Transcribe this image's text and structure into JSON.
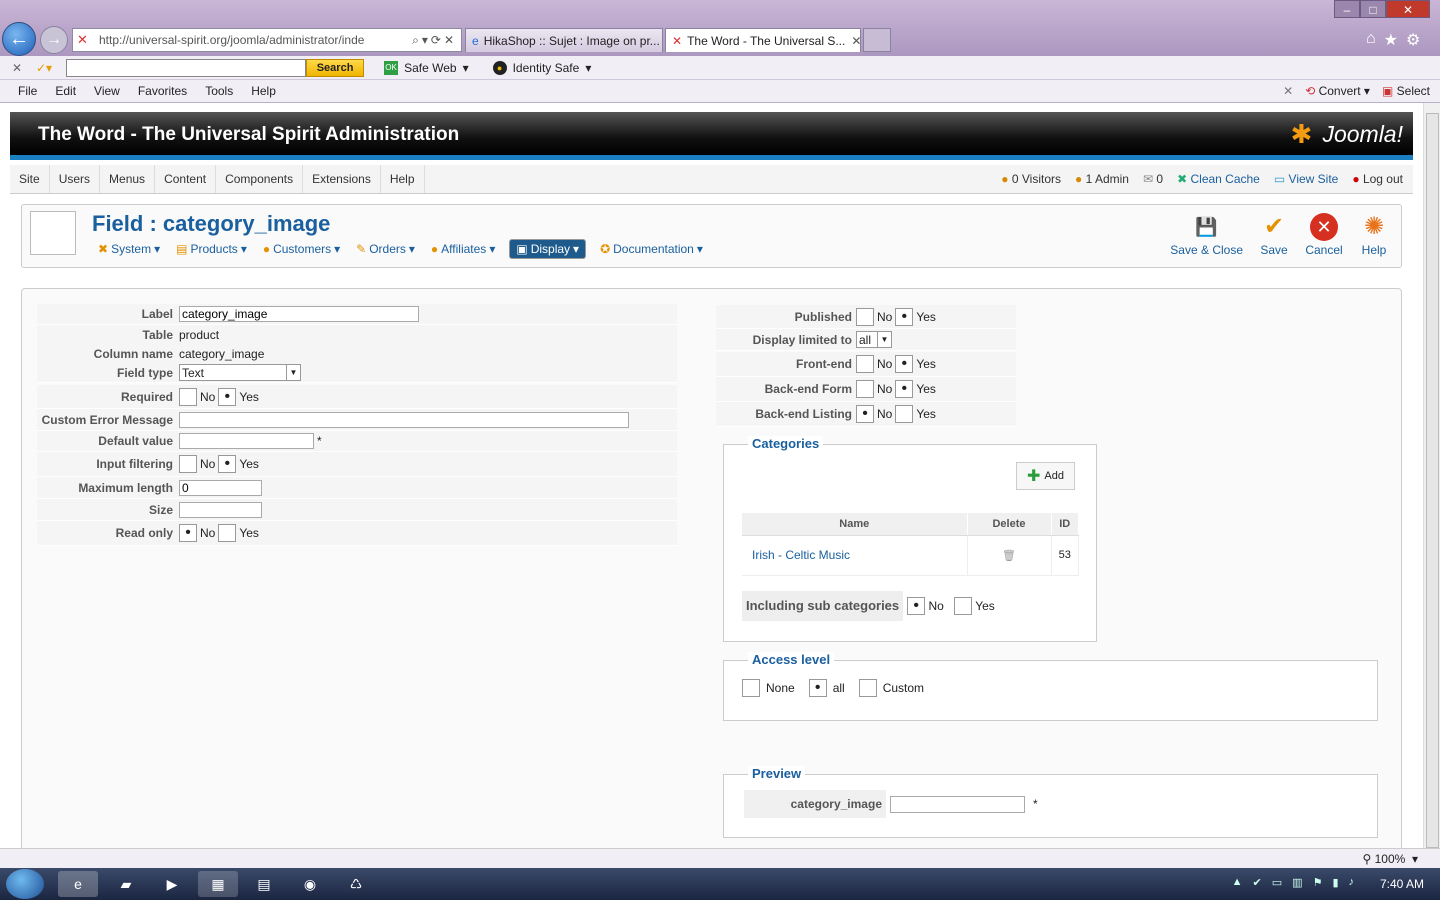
{
  "browser": {
    "url": "http://universal-spirit.org/joomla/administrator/inde",
    "tabs": [
      {
        "title": "HikaShop :: Sujet : Image on pr..."
      },
      {
        "title": "The Word - The Universal S..."
      }
    ],
    "toolbar": {
      "search_button": "Search",
      "safe_web": "Safe Web",
      "identity_safe": "Identity Safe",
      "convert": "Convert",
      "select": "Select"
    },
    "menu": [
      "File",
      "Edit",
      "View",
      "Favorites",
      "Tools",
      "Help"
    ],
    "zoom": "100%"
  },
  "joomla": {
    "site_title": "The Word - The Universal Spirit Administration",
    "logo": "Joomla!",
    "menu": [
      "Site",
      "Users",
      "Menus",
      "Content",
      "Components",
      "Extensions",
      "Help"
    ],
    "status": {
      "visitors": "0 Visitors",
      "admins": "1 Admin",
      "messages": "0",
      "clean_cache": "Clean Cache",
      "view_site": "View Site",
      "logout": "Log out"
    }
  },
  "page": {
    "title": "Field : category_image",
    "hikamenu": [
      "System",
      "Products",
      "Customers",
      "Orders",
      "Affiliates",
      "Display",
      "Documentation"
    ],
    "toolbar": {
      "save_close": "Save & Close",
      "save": "Save",
      "cancel": "Cancel",
      "help": "Help"
    }
  },
  "form": {
    "label": {
      "label": "Label",
      "value": "category_image"
    },
    "table": {
      "label": "Table",
      "value": "product"
    },
    "column": {
      "label": "Column name",
      "value": "category_image"
    },
    "field_type": {
      "label": "Field type",
      "value": "Text"
    },
    "required": {
      "label": "Required",
      "no": "No",
      "yes": "Yes"
    },
    "custom_error": {
      "label": "Custom Error Message",
      "value": ""
    },
    "default_value": {
      "label": "Default value",
      "value": "",
      "star": "*"
    },
    "input_filtering": {
      "label": "Input filtering",
      "no": "No",
      "yes": "Yes"
    },
    "max_length": {
      "label": "Maximum length",
      "value": "0"
    },
    "size": {
      "label": "Size",
      "value": ""
    },
    "read_only": {
      "label": "Read only",
      "no": "No",
      "yes": "Yes"
    }
  },
  "right": {
    "published": {
      "label": "Published",
      "no": "No",
      "yes": "Yes"
    },
    "display_limited": {
      "label": "Display limited to",
      "value": "all"
    },
    "frontend": {
      "label": "Front-end",
      "no": "No",
      "yes": "Yes"
    },
    "backend_form": {
      "label": "Back-end Form",
      "no": "No",
      "yes": "Yes"
    },
    "backend_listing": {
      "label": "Back-end Listing",
      "no": "No",
      "yes": "Yes"
    }
  },
  "categories": {
    "legend": "Categories",
    "add": "Add",
    "headers": [
      "Name",
      "Delete",
      "ID"
    ],
    "rows": [
      {
        "name": "Irish - Celtic Music",
        "id": "53"
      }
    ],
    "include_sub": {
      "label": "Including sub categories",
      "no": "No",
      "yes": "Yes"
    }
  },
  "access": {
    "legend": "Access level",
    "none": "None",
    "all": "all",
    "custom": "Custom"
  },
  "preview": {
    "legend": "Preview",
    "label": "category_image",
    "star": "*"
  },
  "taskbar": {
    "clock": "7:40 AM"
  }
}
